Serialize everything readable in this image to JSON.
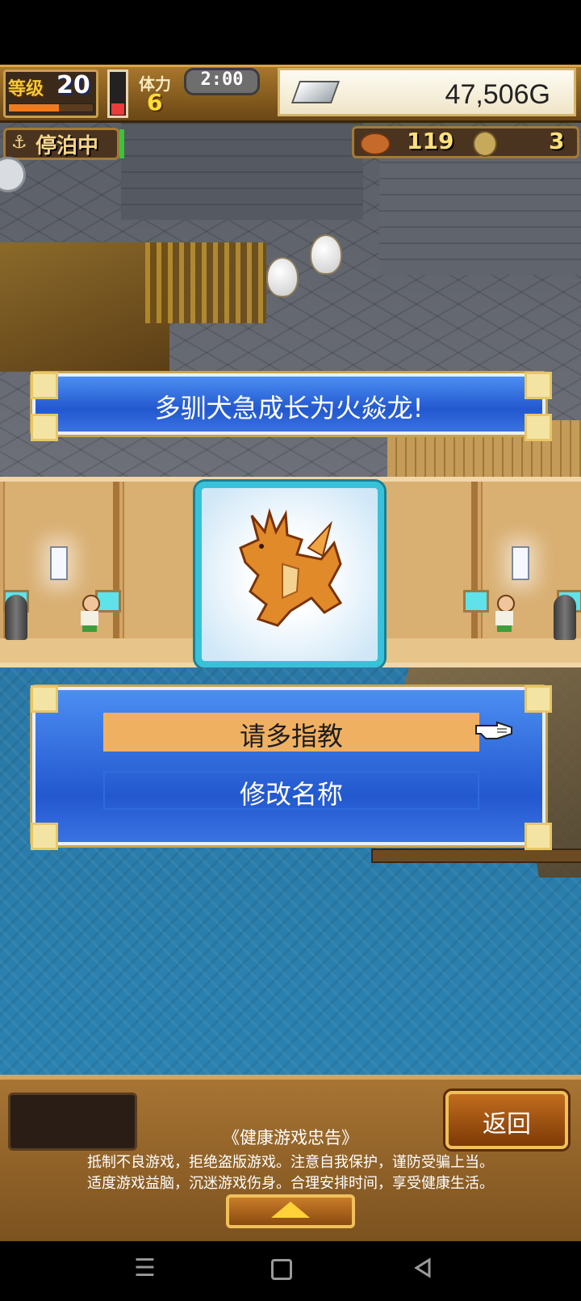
{
  "status": {
    "level_label": "等级",
    "level_value": "20",
    "level_progress": 0.6,
    "stamina_label": "体力",
    "stamina_value": "6",
    "stamina_fill": 0.25,
    "clock": "2:00",
    "money": "47,506G"
  },
  "berth": {
    "label": "停泊中"
  },
  "resources": {
    "food": "119",
    "medals": "3"
  },
  "banner": {
    "message": "多驯犬急成长为火焱龙!"
  },
  "menu": {
    "option1": "请多指教",
    "option2": "修改名称"
  },
  "bottom": {
    "back_label": "返回",
    "notice_title": "《健康游戏忠告》",
    "notice_line1": "抵制不良游戏，拒绝盗版游戏。注意自我保护，谨防受骗上当。",
    "notice_line2": "适度游戏益脑，沉迷游戏伤身。合理安排时间，享受健康生活。"
  },
  "icons": {
    "nav": [
      "menu-icon",
      "home-icon",
      "back-icon"
    ]
  }
}
